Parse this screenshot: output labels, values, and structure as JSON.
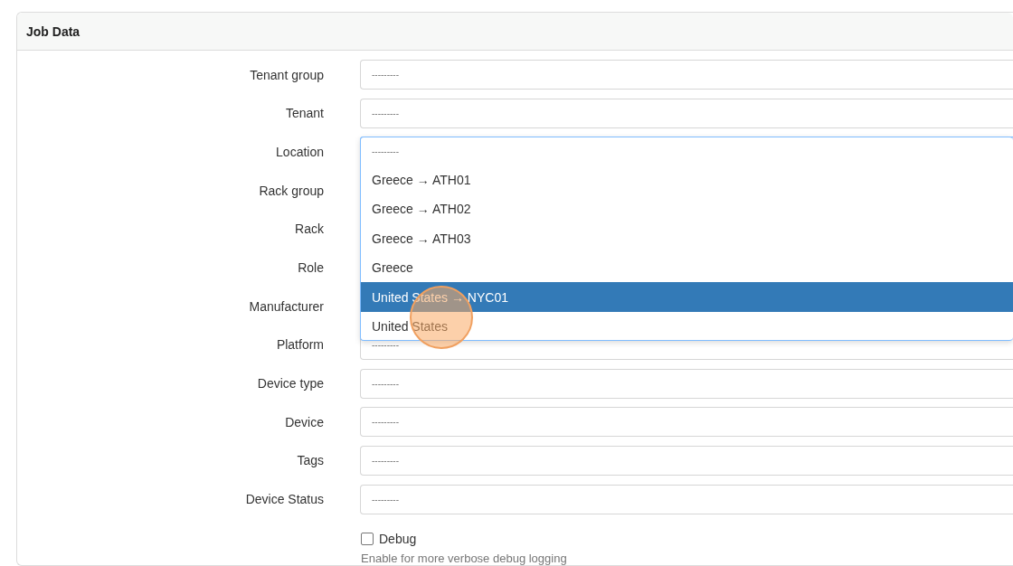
{
  "panel": {
    "title": "Job Data"
  },
  "fields": [
    {
      "label": "Tenant group",
      "placeholder": "---------"
    },
    {
      "label": "Tenant",
      "placeholder": "---------"
    },
    {
      "label": "Location",
      "placeholder": "---------",
      "expanded": true,
      "options": [
        {
          "label": "Greece → ATH01",
          "selected": false
        },
        {
          "label": "Greece → ATH02",
          "selected": false
        },
        {
          "label": "Greece → ATH03",
          "selected": false
        },
        {
          "label": "Greece",
          "selected": false
        },
        {
          "label": "United States → NYC01",
          "selected": true
        },
        {
          "label": "United States",
          "selected": false
        }
      ]
    },
    {
      "label": "Rack group"
    },
    {
      "label": "Rack"
    },
    {
      "label": "Role"
    },
    {
      "label": "Manufacturer"
    },
    {
      "label": "Platform",
      "placeholder": "---------"
    },
    {
      "label": "Device type",
      "placeholder": "---------"
    },
    {
      "label": "Device",
      "placeholder": "---------"
    },
    {
      "label": "Tags",
      "placeholder": "---------"
    },
    {
      "label": "Device Status",
      "placeholder": "---------"
    }
  ],
  "debug": {
    "label": "Debug",
    "checked": false,
    "help": "Enable for more verbose debug logging"
  }
}
